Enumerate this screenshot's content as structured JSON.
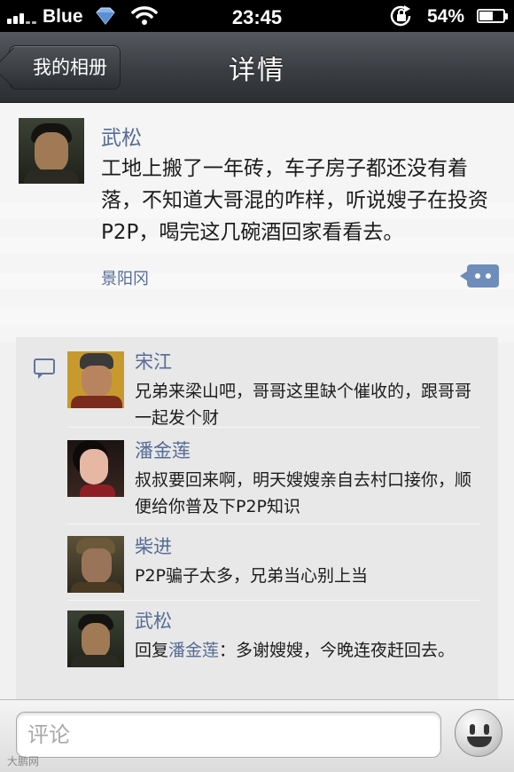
{
  "status_bar": {
    "carrier": "Blue",
    "time": "23:45",
    "battery_percent": "54%",
    "battery_level": 0.54,
    "icons": [
      "signal-icon",
      "vpn-diamond-icon",
      "wifi-icon",
      "rotation-lock-icon",
      "battery-icon"
    ]
  },
  "nav": {
    "back_label": "我的相册",
    "title": "详情"
  },
  "post": {
    "author": "武松",
    "text": "工地上搬了一年砖，车子房子都还没有着落，不知道大哥混的咋样，听说嫂子在投资P2P，喝完这几碗酒回家看看去。",
    "location": "景阳冈",
    "action_icon": "more-dots-icon"
  },
  "comments": [
    {
      "name": "宋江",
      "text": "兄弟来梁山吧，哥哥这里缺个催收的，跟哥哥一起发个财"
    },
    {
      "name": "潘金莲",
      "text": "叔叔要回来啊，明天嫂嫂亲自去村口接你，顺便给你普及下P2P知识"
    },
    {
      "name": "柴进",
      "text": "P2P骗子太多，兄弟当心别上当"
    },
    {
      "name": "武松",
      "reply_prefix": "回复",
      "reply_to": "潘金莲",
      "text": "：多谢嫂嫂，今晚连夜赶回去。"
    }
  ],
  "input": {
    "placeholder": "评论"
  },
  "colors": {
    "link": "#566c96",
    "nav_bar": "#3a3d41",
    "status_bar": "#000000"
  },
  "watermark": "大鹏网"
}
